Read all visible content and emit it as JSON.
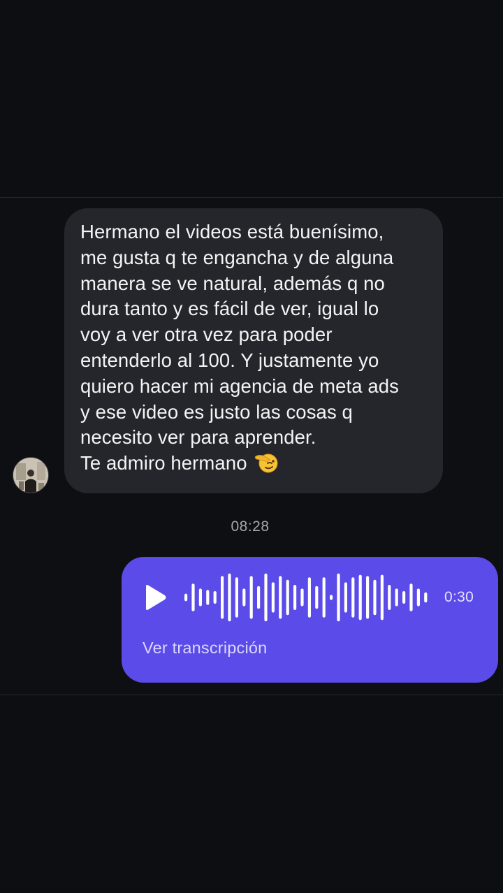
{
  "incoming_message": {
    "lines": [
      "Hermano el videos está buenísimo,",
      "me gusta q te engancha y de alguna",
      "manera se ve natural, además q no",
      "dura tanto y es fácil de ver, igual lo",
      "voy a ver otra vez para poder",
      "entenderlo al 100. Y justamente yo",
      "quiero hacer mi agencia de meta ads",
      "y ese video es justo las cosas q",
      "necesito ver para aprender.",
      "Te admiro hermano"
    ],
    "emoji": "saluting-face-icon"
  },
  "timestamp": "08:28",
  "voice_message": {
    "duration": "0:30",
    "transcript_label": "Ver transcripción",
    "waveform_levels": [
      0.15,
      0.55,
      0.35,
      0.3,
      0.25,
      0.85,
      0.95,
      0.8,
      0.35,
      0.85,
      0.45,
      0.95,
      0.6,
      0.85,
      0.7,
      0.5,
      0.35,
      0.8,
      0.45,
      0.8,
      0.1,
      0.95,
      0.6,
      0.8,
      0.9,
      0.85,
      0.7,
      0.9,
      0.5,
      0.35,
      0.25,
      0.55,
      0.35,
      0.2
    ],
    "accent_color": "#5b4be8"
  },
  "colors": {
    "background": "#0d0e12",
    "incoming_bubble": "#25262b",
    "outgoing_bubble": "#5b4be8"
  }
}
